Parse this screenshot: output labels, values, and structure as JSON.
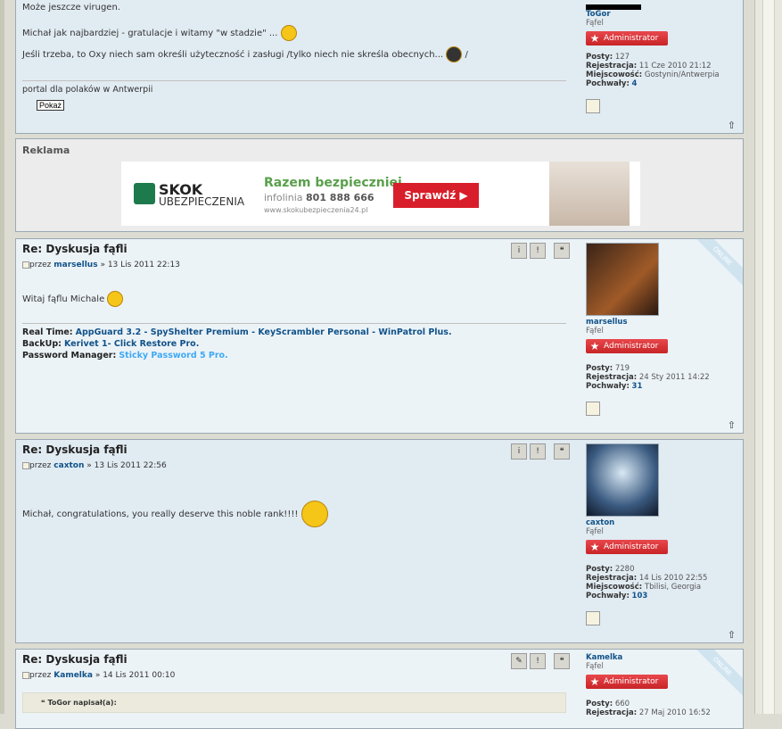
{
  "post_top": {
    "lines": [
      "Może jeszcze virugen.",
      "Michał jak najbardziej - gratulacje i witamy \"w stadzie\" ...",
      "Jeśli trzeba, to Oxy niech sam określi użyteczność i zasługi /tylko niech nie skreśla obecnych..."
    ],
    "slash": "/",
    "sig": "portal dla polaków w Antwerpii",
    "show_button": "Pokaż",
    "profile": {
      "username": "ToGor",
      "rank": "Fąfel",
      "badge": "Administrator",
      "posts_label": "Posty:",
      "posts": "127",
      "reg_label": "Rejestracja:",
      "reg": "11 Cze 2010 21:12",
      "loc_label": "Miejscowość:",
      "loc": "Gostynin/Antwerpia",
      "thanks_label": "Pochwały:",
      "thanks": "4"
    }
  },
  "ad": {
    "title": "Reklama",
    "brand1": "SKOK",
    "brand2": "UBEZPIECZENIA",
    "headline": "Razem bezpieczniej",
    "phone_label": "infolinia",
    "phone": "801 888 666",
    "url": "www.skokubezpieczenia24.pl",
    "cta": "Sprawdź"
  },
  "post1": {
    "title": "Re: Dyskusja fąfli",
    "by": "przez",
    "author": "marsellus",
    "date": "» 13 Lis 2011 22:13",
    "text": "Witaj fąflu Michale",
    "sig_realtime_label": "Real Time:",
    "sig_realtime": "AppGuard 3.2 - SpyShelter Premium - KeyScrambler Personal - WinPatrol Plus.",
    "sig_backup_label": "BackUp:",
    "sig_backup": "Kerivet 1- Click Restore Pro.",
    "sig_pm_label": "Password Manager:",
    "sig_pm": "Sticky Password 5 Pro.",
    "online": "ONLINE",
    "profile": {
      "username": "marsellus",
      "rank": "Fąfel",
      "badge": "Administrator",
      "posts_label": "Posty:",
      "posts": "719",
      "reg_label": "Rejestracja:",
      "reg": "24 Sty 2011 14:22",
      "thanks_label": "Pochwały:",
      "thanks": "31"
    }
  },
  "post2": {
    "title": "Re: Dyskusja fąfli",
    "by": "przez",
    "author": "caxton",
    "date": "» 13 Lis 2011 22:56",
    "text": "Michał, congratulations, you really deserve this noble rank!!!!",
    "profile": {
      "username": "caxton",
      "rank": "Fąfel",
      "badge": "Administrator",
      "posts_label": "Posty:",
      "posts": "2280",
      "reg_label": "Rejestracja:",
      "reg": "14 Lis 2010 22:55",
      "loc_label": "Miejscowość:",
      "loc": "Tbilisi, Georgia",
      "thanks_label": "Pochwały:",
      "thanks": "103"
    }
  },
  "post3": {
    "title": "Re: Dyskusja fąfli",
    "by": "przez",
    "author": "Kamelka",
    "date": "» 14 Lis 2011 00:10",
    "quote": "ToGor napisał(a):",
    "online": "ONLINE",
    "profile": {
      "username": "Kamelka",
      "rank": "Fąfel",
      "badge": "Administrator",
      "posts_label": "Posty:",
      "posts": "660",
      "reg_label": "Rejestracja:",
      "reg": "27 Maj 2010 16:52"
    }
  },
  "colors": {
    "admin": "#d63034",
    "link": "#105289",
    "post_bg": "#e1ebf2"
  }
}
